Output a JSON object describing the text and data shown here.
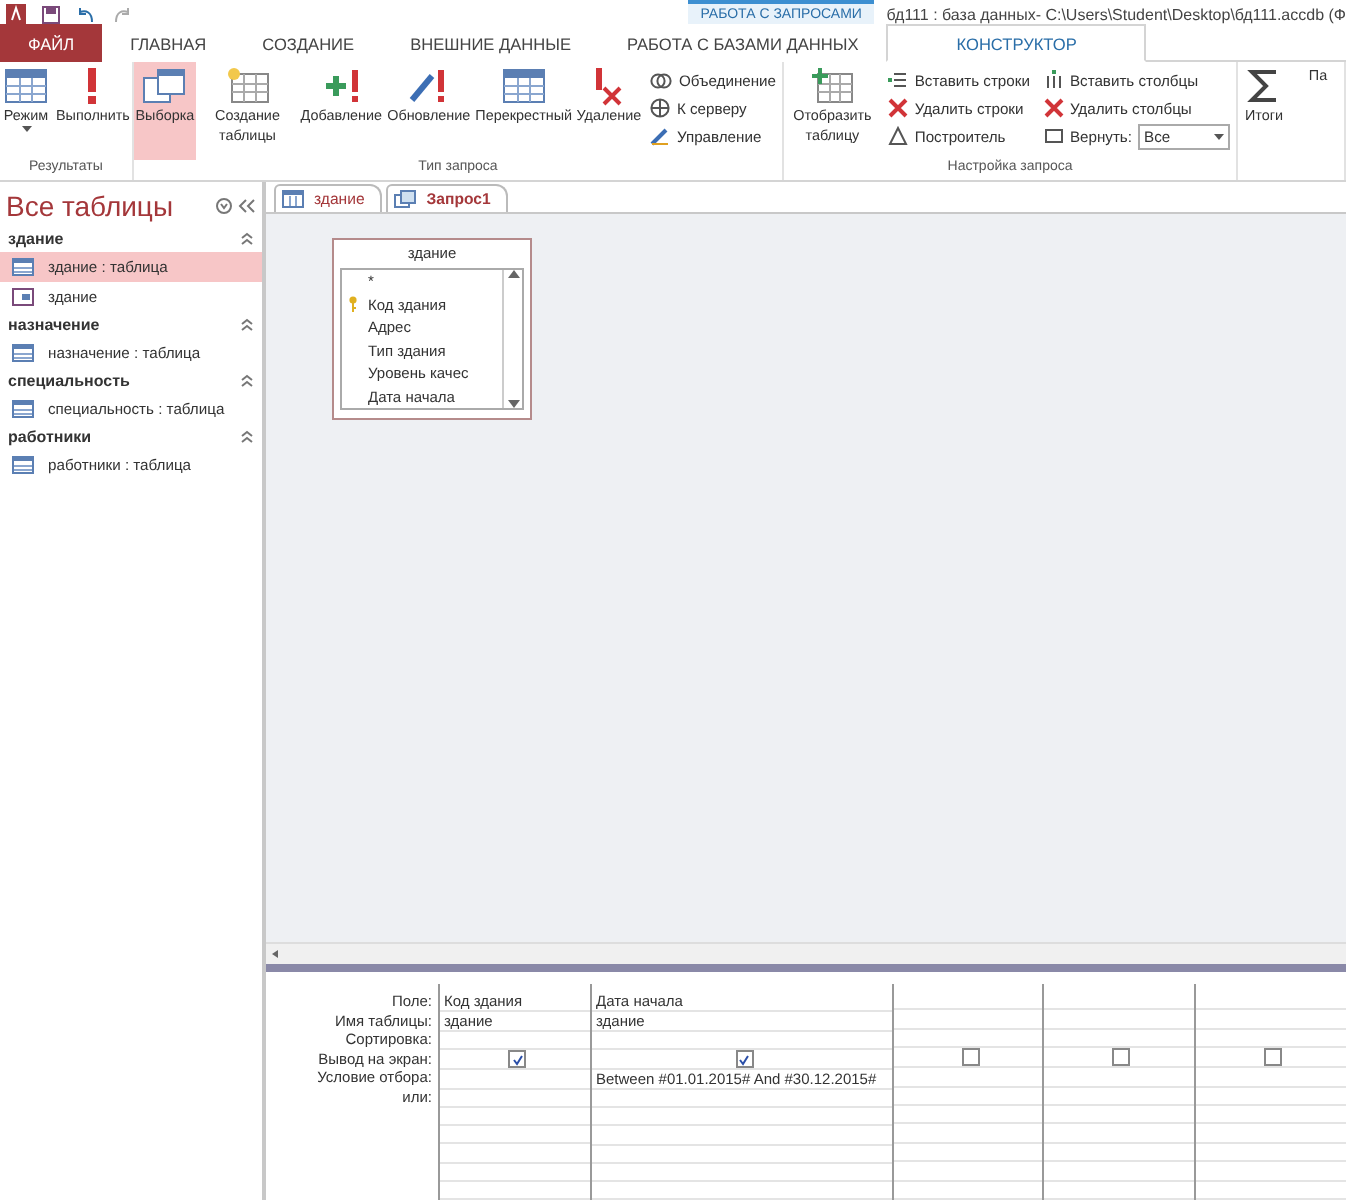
{
  "title_bar": {
    "context_tab": "РАБОТА С ЗАПРОСАМИ",
    "title": "бд111 : база данных- C:\\Users\\Student\\Desktop\\бд111.accdb (Ф"
  },
  "ribbon_tabs": [
    {
      "label": "ФАЙЛ",
      "kind": "file",
      "selected": false
    },
    {
      "label": "ГЛАВНАЯ",
      "kind": "normal",
      "selected": false
    },
    {
      "label": "СОЗДАНИЕ",
      "kind": "normal",
      "selected": false
    },
    {
      "label": "ВНЕШНИЕ ДАННЫЕ",
      "kind": "normal",
      "selected": false
    },
    {
      "label": "РАБОТА С БАЗАМИ ДАННЫХ",
      "kind": "normal",
      "selected": false
    },
    {
      "label": "КОНСТРУКТОР",
      "kind": "normal",
      "selected": true
    }
  ],
  "ribbon_groups": [
    {
      "label": "Результаты",
      "items": [
        {
          "kind": "big",
          "label": "Режим",
          "dropdown": true,
          "selected": false
        },
        {
          "kind": "big",
          "label": "Выполнить",
          "dropdown": false,
          "selected": false
        }
      ]
    },
    {
      "label": "Тип запроса",
      "items": [
        {
          "kind": "big",
          "label": "Выборка",
          "dropdown": false,
          "selected": true
        },
        {
          "kind": "big",
          "label": "Создание таблицы",
          "dropdown": false,
          "selected": false
        },
        {
          "kind": "big",
          "label": "Добавление",
          "dropdown": false,
          "selected": false
        },
        {
          "kind": "big",
          "label": "Обновление",
          "dropdown": false,
          "selected": false
        },
        {
          "kind": "big",
          "label": "Перекрестный",
          "dropdown": false,
          "selected": false
        },
        {
          "kind": "big",
          "label": "Удаление",
          "dropdown": false,
          "selected": false
        },
        {
          "kind": "stack",
          "items": [
            {
              "label": "Объединение"
            },
            {
              "label": "К серверу"
            },
            {
              "label": "Управление"
            }
          ]
        }
      ]
    },
    {
      "label": "Настройка запроса",
      "items": [
        {
          "kind": "big",
          "label": "Отобразить таблицу",
          "dropdown": false,
          "selected": false
        },
        {
          "kind": "stack",
          "items": [
            {
              "label": "Вставить строки"
            },
            {
              "label": "Удалить строки"
            },
            {
              "label": "Построитель"
            }
          ]
        },
        {
          "kind": "stack",
          "items": [
            {
              "label": "Вставить столбцы"
            },
            {
              "label": "Удалить столбцы"
            },
            {
              "label": "Вернуть:",
              "value": "Все"
            }
          ]
        }
      ]
    },
    {
      "items": [
        {
          "kind": "big",
          "label": "Итоги",
          "dropdown": false,
          "selected": false
        },
        {
          "kind": "big",
          "label": "Па",
          "dropdown": false,
          "selected": false
        }
      ]
    }
  ],
  "nav": {
    "title": "Все таблицы",
    "groups": [
      {
        "name": "здание",
        "items": [
          {
            "label": "здание : таблица",
            "kind": "table",
            "selected": true
          },
          {
            "label": "здание",
            "kind": "form",
            "selected": false
          }
        ]
      },
      {
        "name": "назначение",
        "items": [
          {
            "label": "назначение : таблица",
            "kind": "table",
            "selected": false
          }
        ]
      },
      {
        "name": "специальность",
        "items": [
          {
            "label": "специальность : таблица",
            "kind": "table",
            "selected": false
          }
        ]
      },
      {
        "name": "работники",
        "items": [
          {
            "label": "работники : таблица",
            "kind": "table",
            "selected": false
          }
        ]
      }
    ]
  },
  "doc_tabs": [
    {
      "label": "здание",
      "kind": "table",
      "selected": false
    },
    {
      "label": "Запрос1",
      "kind": "query",
      "selected": true
    }
  ],
  "table_box": {
    "title": "здание",
    "fields": [
      {
        "label": "*",
        "key": false
      },
      {
        "label": "Код здания",
        "key": true
      },
      {
        "label": "Адрес",
        "key": false
      },
      {
        "label": "Тип здания",
        "key": false
      },
      {
        "label": "Уровень качес",
        "key": false
      },
      {
        "label": "Дата начала",
        "key": false
      }
    ]
  },
  "grid": {
    "row_labels": [
      "Поле:",
      "Имя таблицы:",
      "Сортировка:",
      "Вывод на экран:",
      "Условие отбора:",
      "или:"
    ],
    "columns": [
      {
        "field": "Код здания",
        "table": "здание",
        "show": true
      },
      {
        "field": "Дата начала",
        "table": "здание",
        "show": true,
        "criteria": "Between #01.01.2015# And #30.12.2015#"
      },
      {
        "show": false
      },
      {
        "show": false
      },
      {
        "show": false
      }
    ]
  }
}
